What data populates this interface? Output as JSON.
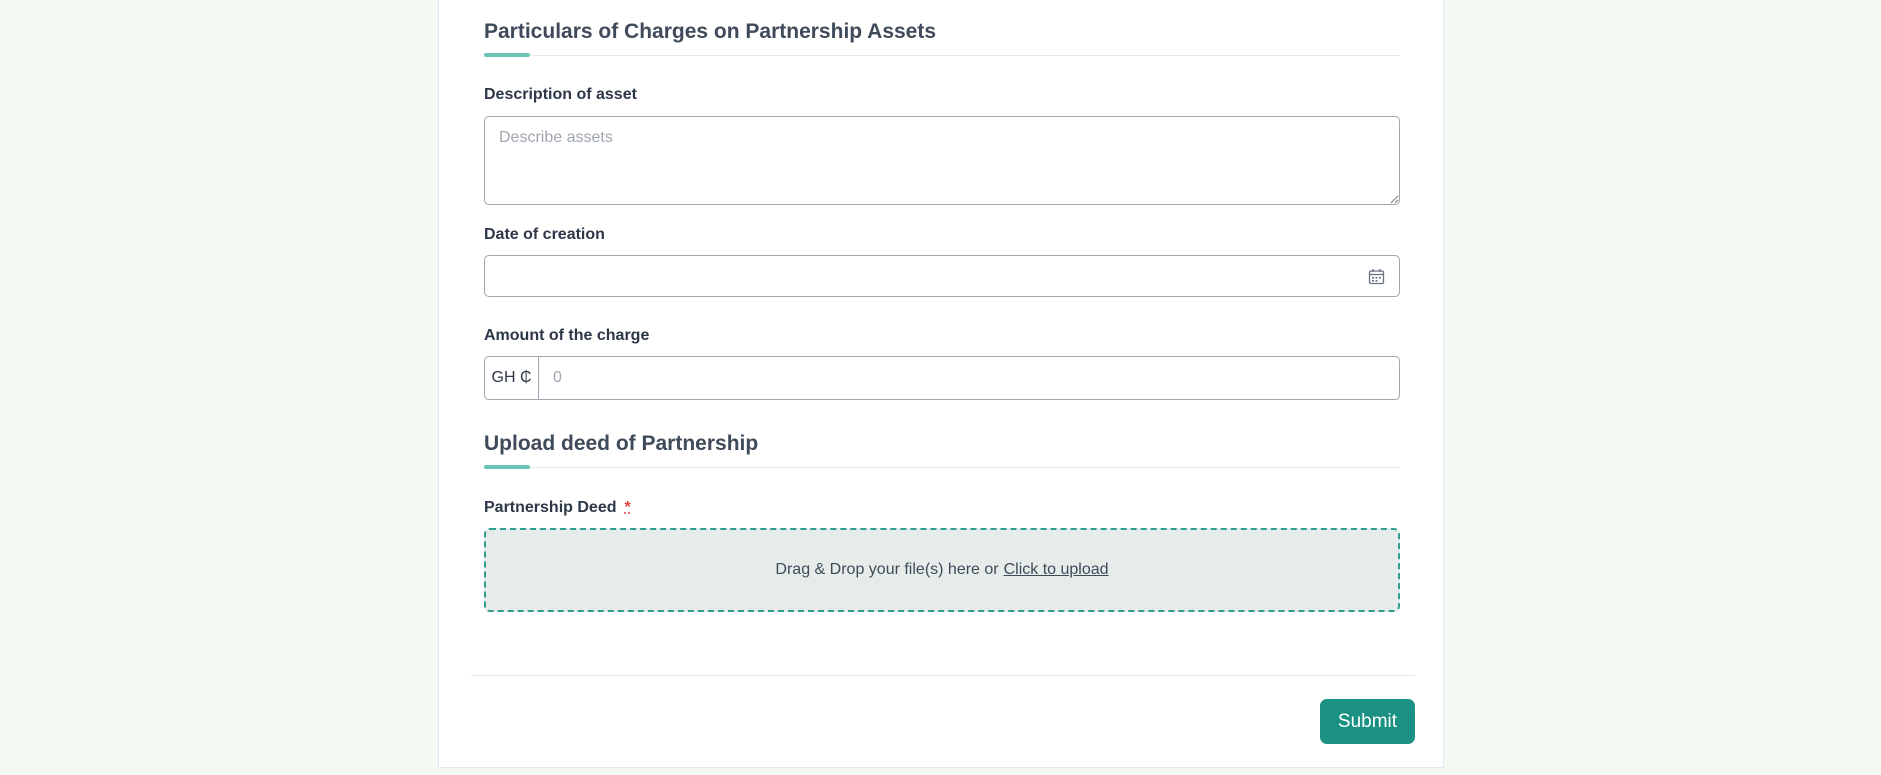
{
  "sections": {
    "charges": {
      "title": "Particulars of Charges on Partnership Assets"
    },
    "upload": {
      "title": "Upload deed of Partnership"
    }
  },
  "fields": {
    "description": {
      "label": "Description of asset",
      "placeholder": "Describe assets",
      "value": ""
    },
    "date_of_creation": {
      "label": "Date of creation",
      "value": "",
      "icon": "calendar-icon"
    },
    "amount": {
      "label": "Amount of the charge",
      "currency_prefix": "GH ₵",
      "placeholder": "0",
      "value": ""
    },
    "partnership_deed": {
      "label": "Partnership Deed",
      "required_marker": "*",
      "dropzone_text": "Drag & Drop your file(s) here or",
      "dropzone_link": "Click to upload"
    }
  },
  "actions": {
    "submit_label": "Submit"
  },
  "colors": {
    "accent": "#1a9182",
    "accent_light": "#6cc4b6",
    "page_background": "#f5f9f4",
    "required": "#e53e3e"
  }
}
